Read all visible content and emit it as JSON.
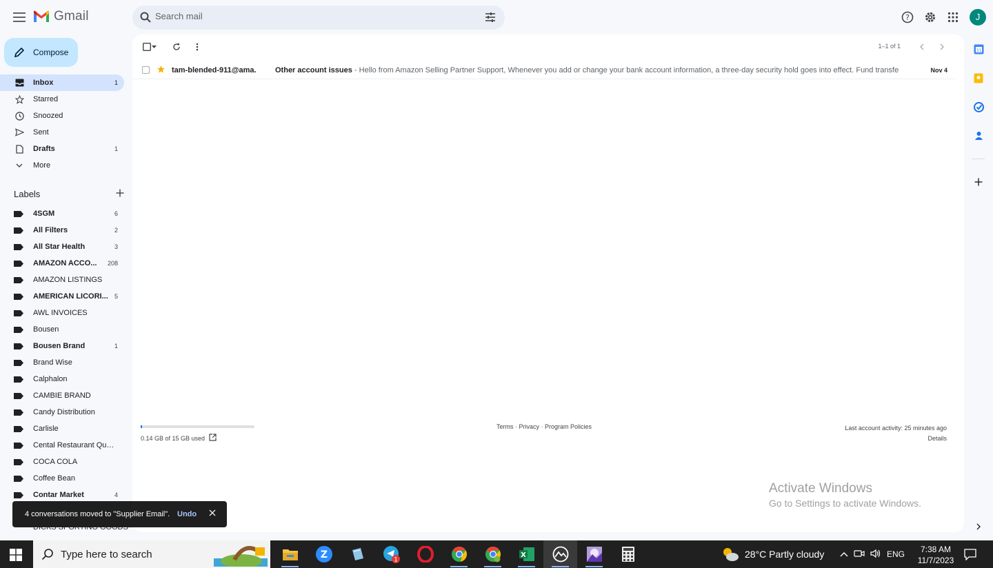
{
  "app": {
    "name": "Gmail"
  },
  "search": {
    "placeholder": "Search mail"
  },
  "compose": {
    "label": "Compose"
  },
  "nav": [
    {
      "label": "Inbox",
      "count": "1",
      "icon": "inbox-icon"
    },
    {
      "label": "Starred",
      "count": "",
      "icon": "star-icon"
    },
    {
      "label": "Snoozed",
      "count": "",
      "icon": "clock-icon"
    },
    {
      "label": "Sent",
      "count": "",
      "icon": "send-icon"
    },
    {
      "label": "Drafts",
      "count": "1",
      "icon": "draft-icon"
    },
    {
      "label": "More",
      "count": "",
      "icon": "chevron-down-icon"
    }
  ],
  "labels_title": "Labels",
  "labels": [
    {
      "name": "4SGM",
      "count": "6"
    },
    {
      "name": "All Filters",
      "count": "2"
    },
    {
      "name": "All Star Health",
      "count": "3"
    },
    {
      "name": "AMAZON ACCO...",
      "count": "208"
    },
    {
      "name": "AMAZON LISTINGS",
      "count": ""
    },
    {
      "name": "AMERICAN LICORI...",
      "count": "5"
    },
    {
      "name": "AWL INVOICES",
      "count": ""
    },
    {
      "name": "Bousen",
      "count": ""
    },
    {
      "name": "Bousen Brand",
      "count": "1"
    },
    {
      "name": "Brand Wise",
      "count": ""
    },
    {
      "name": "Calphalon",
      "count": ""
    },
    {
      "name": "CAMBIE BRAND",
      "count": ""
    },
    {
      "name": "Candy Distribution",
      "count": ""
    },
    {
      "name": "Carlisle",
      "count": ""
    },
    {
      "name": "Cental Restaurant Quot...",
      "count": ""
    },
    {
      "name": "COCA COLA",
      "count": ""
    },
    {
      "name": "Coffee Bean",
      "count": ""
    },
    {
      "name": "Contar Market",
      "count": "4"
    }
  ],
  "hidden_label": "DICKS SPORTING GOODS",
  "pager": "1–1 of 1",
  "emails": [
    {
      "sender": "tam-blended-911@ama.",
      "subject": "Other account issues",
      "snippet": " - Hello from Amazon Selling Partner Support, Whenever you add or change your bank account information, a three-day security hold goes into effect. Fund transfers ...",
      "date": "Nov 4"
    }
  ],
  "footer": {
    "storage": "0.14 GB of 15 GB used",
    "storage_fraction": 0.0093,
    "links": "Terms · Privacy · Program Policies",
    "activity": "Last account activity: 25 minutes ago",
    "details": "Details"
  },
  "watermark": {
    "line1": "Activate Windows",
    "line2": "Go to Settings to activate Windows."
  },
  "toast": {
    "message": "4 conversations moved to \"Supplier Email\".",
    "undo": "Undo"
  },
  "taskbar": {
    "search_placeholder": "Type here to search",
    "weather": "28°C  Partly cloudy",
    "lang": "ENG",
    "time": "7:38 AM",
    "date": "11/7/2023",
    "telegram_badge": "1"
  },
  "colors": {
    "accent": "#0b57d0",
    "compose_bg": "#c2e7ff",
    "active_nav": "#d3e3fd",
    "avatar": "#00897b"
  }
}
